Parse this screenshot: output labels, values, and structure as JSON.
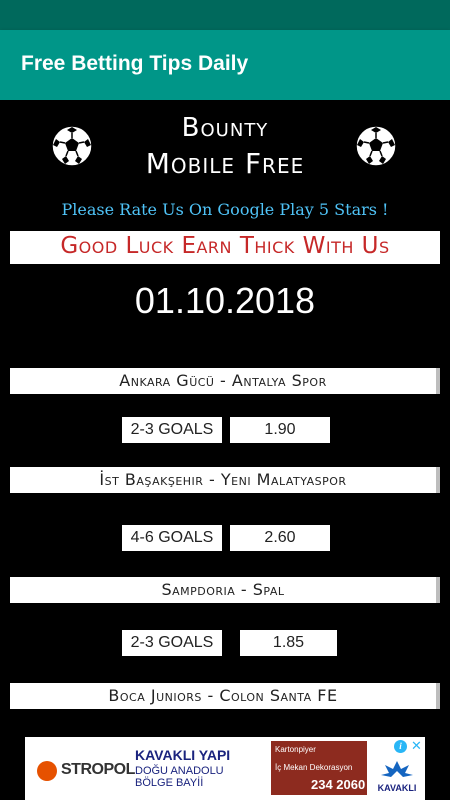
{
  "app": {
    "title": "Free Betting Tips Daily"
  },
  "brand": {
    "line1": "Bounty",
    "line2": "Mobile Free"
  },
  "rate_text": "Please Rate Us On Google Play 5 Stars !",
  "luck_text": "Good Luck Earn Thick With Us",
  "date": "01.10.2018",
  "matches": [
    {
      "teams": "Ankara Gücü - Antalya Spor",
      "tip": "2-3 GOALS",
      "odds": "1.90"
    },
    {
      "teams": "İst Başakşehir - Yeni Malatyaspor",
      "tip": "4-6 GOALS",
      "odds": "2.60"
    },
    {
      "teams": "Sampdoria - Spal",
      "tip": "2-3 GOALS",
      "odds": "1.85"
    },
    {
      "teams": "Boca Juniors - Colon Santa FE"
    }
  ],
  "ad": {
    "advertiser1": "STROPOL",
    "headline": "KAVAKLI YAPI",
    "subline": "DOĞU ANADOLU BÖLGE BAYİİ",
    "box_line1": "Kartonpiyer",
    "box_line2": "İç Mekan Dekorasyon",
    "box_phone": "234 2060",
    "logo_text": "KAVAKLI",
    "info_icon": "info-icon",
    "close_icon": "close-icon"
  },
  "colors": {
    "app_bar": "#009688",
    "status_bar": "#00695c",
    "rate_text": "#4fc3f7",
    "luck_text": "#c62828",
    "background": "#000000"
  }
}
